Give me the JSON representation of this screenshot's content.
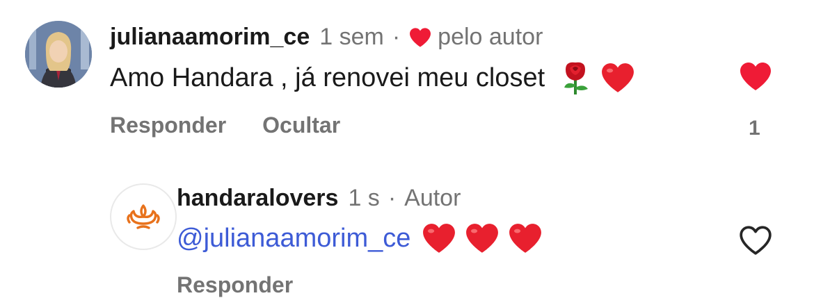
{
  "comments": [
    {
      "username": "julianaamorim_ce",
      "time": "1 sem",
      "liked_by_author": "pelo autor",
      "text": "Amo Handara , já renovei meu closet",
      "emojis": [
        "rose-emoji",
        "red-heart-emoji"
      ],
      "actions": [
        "Responder",
        "Ocultar"
      ],
      "liked": true,
      "like_count": "1"
    },
    {
      "username": "handaralovers",
      "time": "1 s",
      "role": "Autor",
      "mention": "@julianaamorim_ce",
      "emojis": [
        "red-heart-emoji",
        "red-heart-emoji",
        "red-heart-emoji"
      ],
      "actions": [
        "Responder"
      ],
      "liked": false
    }
  ],
  "colors": {
    "heart": "#ef1b36",
    "mention": "#3d5bd6",
    "secondary_text": "#737373",
    "brand_orange": "#e8721c"
  }
}
